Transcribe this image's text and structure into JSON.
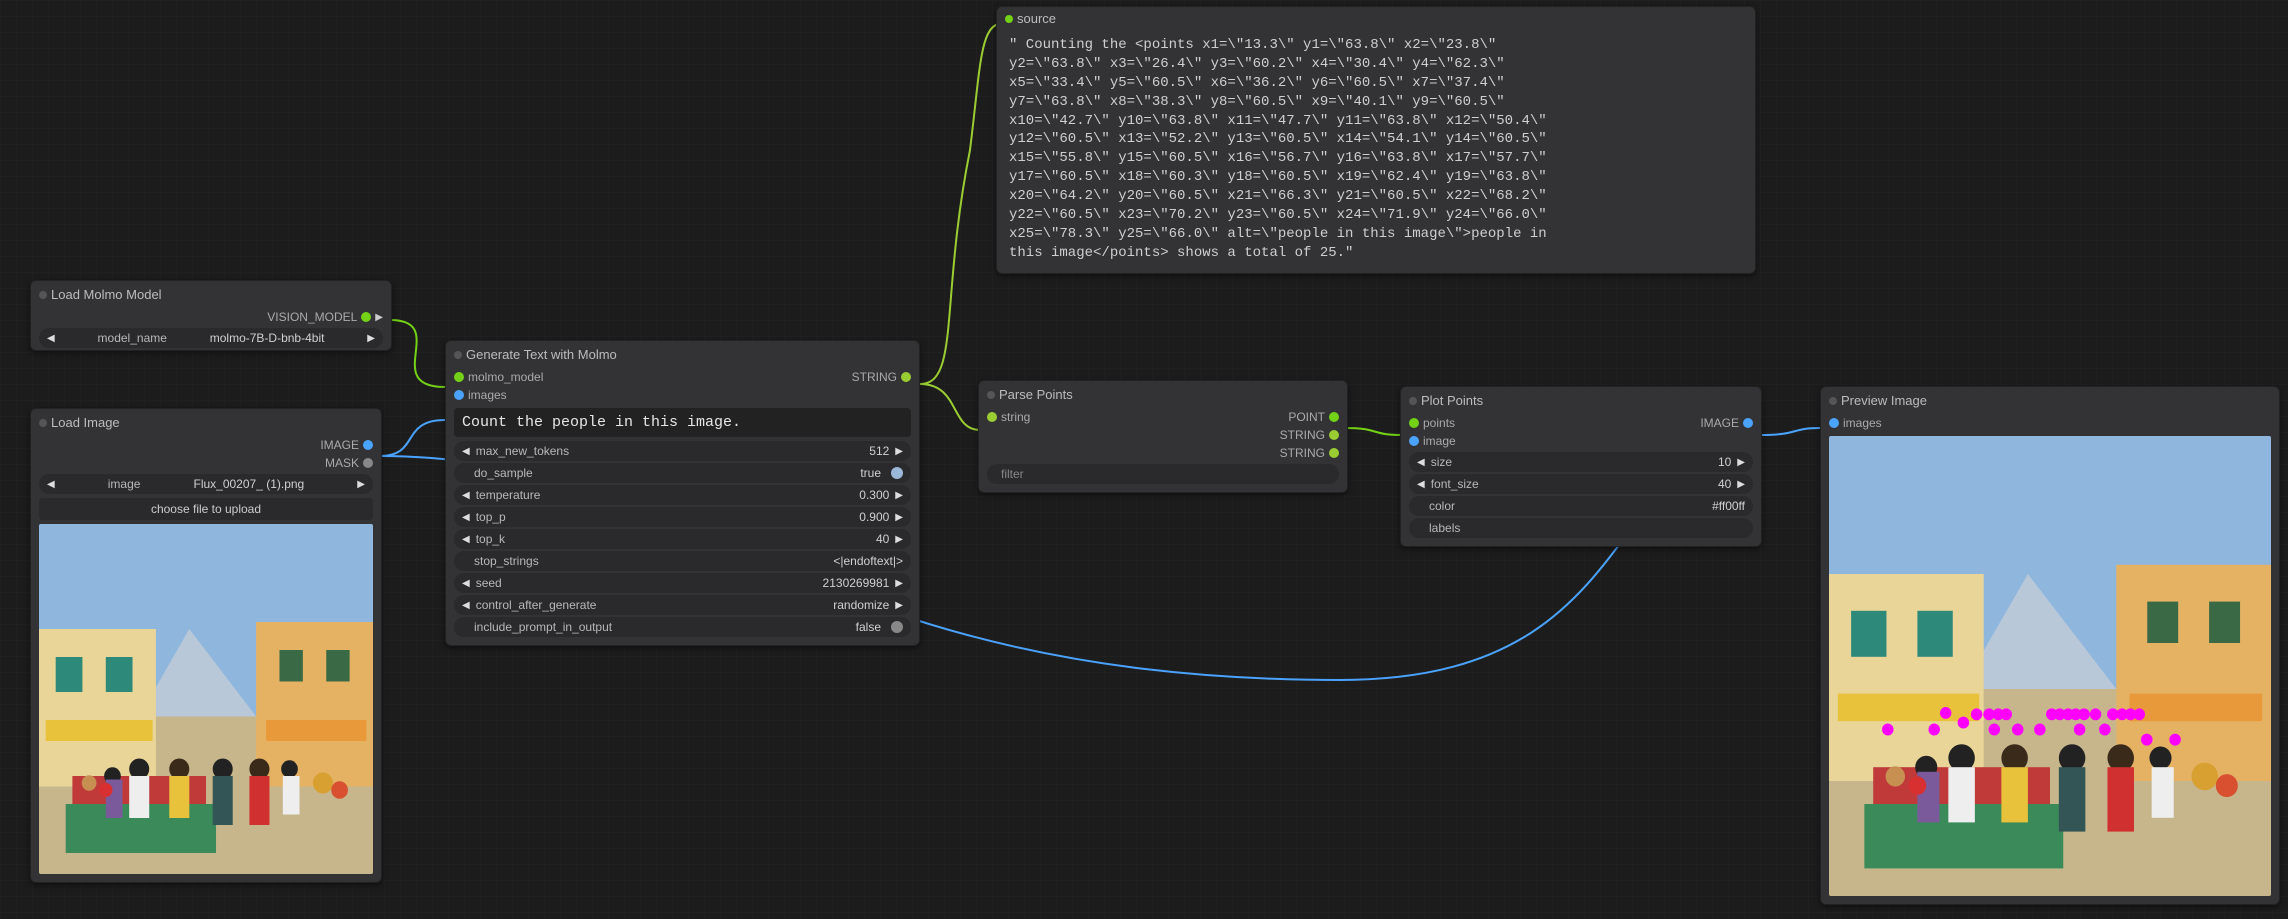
{
  "nodes": {
    "load_model": {
      "title": "Load Molmo Model",
      "output_label": "VISION_MODEL",
      "param_name": "model_name",
      "param_value": "molmo-7B-D-bnb-4bit"
    },
    "load_image": {
      "title": "Load Image",
      "output_image": "IMAGE",
      "output_mask": "MASK",
      "param_name": "image",
      "param_value": "Flux_00207_ (1).png",
      "upload_label": "choose file to upload"
    },
    "generate": {
      "title": "Generate Text with Molmo",
      "input_model": "molmo_model",
      "input_images": "images",
      "output": "STRING",
      "prompt": "Count the people in this image.",
      "params": {
        "max_new_tokens": {
          "label": "max_new_tokens",
          "value": "512"
        },
        "do_sample": {
          "label": "do_sample",
          "value": "true"
        },
        "temperature": {
          "label": "temperature",
          "value": "0.300"
        },
        "top_p": {
          "label": "top_p",
          "value": "0.900"
        },
        "top_k": {
          "label": "top_k",
          "value": "40"
        },
        "stop_strings": {
          "label": "stop_strings",
          "value": "<|endoftext|>"
        },
        "seed": {
          "label": "seed",
          "value": "2130269981"
        },
        "control_after_generate": {
          "label": "control_after_generate",
          "value": "randomize"
        },
        "include_prompt_in_output": {
          "label": "include_prompt_in_output",
          "value": "false"
        }
      }
    },
    "source": {
      "title": "source",
      "text": "\" Counting the <points x1=\\\"13.3\\\" y1=\\\"63.8\\\" x2=\\\"23.8\\\"\ny2=\\\"63.8\\\" x3=\\\"26.4\\\" y3=\\\"60.2\\\" x4=\\\"30.4\\\" y4=\\\"62.3\\\"\nx5=\\\"33.4\\\" y5=\\\"60.5\\\" x6=\\\"36.2\\\" y6=\\\"60.5\\\" x7=\\\"37.4\\\"\ny7=\\\"63.8\\\" x8=\\\"38.3\\\" y8=\\\"60.5\\\" x9=\\\"40.1\\\" y9=\\\"60.5\\\"\nx10=\\\"42.7\\\" y10=\\\"63.8\\\" x11=\\\"47.7\\\" y11=\\\"63.8\\\" x12=\\\"50.4\\\"\ny12=\\\"60.5\\\" x13=\\\"52.2\\\" y13=\\\"60.5\\\" x14=\\\"54.1\\\" y14=\\\"60.5\\\"\nx15=\\\"55.8\\\" y15=\\\"60.5\\\" x16=\\\"56.7\\\" y16=\\\"63.8\\\" x17=\\\"57.7\\\"\ny17=\\\"60.5\\\" x18=\\\"60.3\\\" y18=\\\"60.5\\\" x19=\\\"62.4\\\" y19=\\\"63.8\\\"\nx20=\\\"64.2\\\" y20=\\\"60.5\\\" x21=\\\"66.3\\\" y21=\\\"60.5\\\" x22=\\\"68.2\\\"\ny22=\\\"60.5\\\" x23=\\\"70.2\\\" y23=\\\"60.5\\\" x24=\\\"71.9\\\" y24=\\\"66.0\\\"\nx25=\\\"78.3\\\" y25=\\\"66.0\\\" alt=\\\"people in this image\\\">people in\nthis image</points> shows a total of 25.\""
    },
    "parse_points": {
      "title": "Parse Points",
      "input": "string",
      "outputs": {
        "point": "POINT",
        "string1": "STRING",
        "string2": "STRING"
      },
      "filter_label": "filter"
    },
    "plot_points": {
      "title": "Plot Points",
      "inputs": {
        "points": "points",
        "image": "image"
      },
      "output": "IMAGE",
      "params": {
        "size": {
          "label": "size",
          "value": "10"
        },
        "font_size": {
          "label": "font_size",
          "value": "40"
        },
        "color": {
          "label": "color",
          "value": "#ff00ff"
        },
        "labels": {
          "label": "labels",
          "value": ""
        }
      }
    },
    "preview": {
      "title": "Preview Image",
      "input": "images"
    }
  }
}
